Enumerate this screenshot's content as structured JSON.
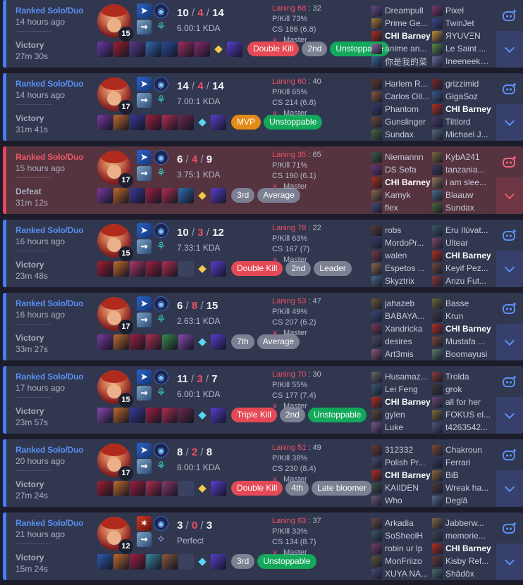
{
  "colors": {
    "win": "#4a7df0",
    "loss": "#e2475d",
    "badge_red": "#e44a55",
    "badge_green": "#13a85a",
    "badge_gray": "#7b8092",
    "badge_orange": "#e38b17"
  },
  "matches": [
    {
      "result_type": "win",
      "queue": "Ranked Solo/Duo",
      "ago": "14 hours ago",
      "result": "Victory",
      "duration": "27m 30s",
      "level": "15",
      "spell": "flash",
      "secondary": "resolve",
      "k": "10",
      "d": "4",
      "a": "14",
      "ratio": "6.00:1 KDA",
      "laning": "Laning 68",
      "laning_opp": "32",
      "pkill": "P/Kill 73%",
      "cs": "CS 186 (6.8)",
      "rank": "Master",
      "items": [
        "#6d3aa8",
        "#a02030",
        "#5b3a8c",
        "#2f6cb0",
        "#2b4d9c",
        "#a02d5e",
        "#8a2a6e",
        "ward",
        "#5a3ed0"
      ],
      "badges": [
        {
          "t": "Double Kill",
          "c": "red"
        },
        {
          "t": "2nd",
          "c": "gray"
        },
        {
          "t": "Unstoppable",
          "c": "green"
        }
      ],
      "blue": [
        {
          "n": "Dreampull",
          "c": "#6a4a8a"
        },
        {
          "n": "Prime Ge...",
          "c": "#a87a3a"
        },
        {
          "n": "CHI Barney",
          "c": "#b03020",
          "me": true
        },
        {
          "n": "anime an...",
          "c": "#8a6aa0"
        },
        {
          "n": "你是我的菜",
          "c": "#3a6a9a"
        }
      ],
      "red": [
        {
          "n": "Pixel",
          "c": "#7a3a6a"
        },
        {
          "n": "TwinJet",
          "c": "#3a4a8a"
        },
        {
          "n": "ЯYUVΞN",
          "c": "#c08a3a"
        },
        {
          "n": "Le Saint ...",
          "c": "#5a8a4a"
        },
        {
          "n": "Ineeneekh...",
          "c": "#6a6a9a"
        }
      ]
    },
    {
      "result_type": "win",
      "queue": "Ranked Solo/Duo",
      "ago": "14 hours ago",
      "result": "Victory",
      "duration": "31m 41s",
      "level": "17",
      "spell": "flash",
      "secondary": "resolve",
      "k": "14",
      "d": "4",
      "a": "14",
      "ratio": "7.00:1 KDA",
      "laning": "Laning 60",
      "laning_opp": "40",
      "pkill": "P/Kill 65%",
      "cs": "CS 214 (6.8)",
      "rank": "Master",
      "items": [
        "#7a3aa0",
        "#c06a2a",
        "#3a3a9a",
        "#a02040",
        "#b03050",
        "#6a2a4a",
        "ward-blue",
        "#5a3ed0"
      ],
      "badges": [
        {
          "t": "MVP",
          "c": "orange"
        },
        {
          "t": "Unstoppable",
          "c": "green"
        }
      ],
      "blue": [
        {
          "n": "Harlem R...",
          "c": "#5a3a2a"
        },
        {
          "n": "Carlos Oil...",
          "c": "#8a5a3a"
        },
        {
          "n": "Phantom",
          "c": "#3a3a6a"
        },
        {
          "n": "Gunslinger",
          "c": "#6a4a3a"
        },
        {
          "n": "Sundax",
          "c": "#4a6a3a"
        }
      ],
      "red": [
        {
          "n": "grizzimid",
          "c": "#7a2a2a"
        },
        {
          "n": "GigaSoz",
          "c": "#3a5a8a"
        },
        {
          "n": "CHI Barney",
          "c": "#b03020",
          "me": true
        },
        {
          "n": "Tiltlord",
          "c": "#4a3a6a"
        },
        {
          "n": "Michael J...",
          "c": "#5a6a7a"
        }
      ]
    },
    {
      "result_type": "loss",
      "queue": "Ranked Solo/Duo",
      "ago": "15 hours ago",
      "result": "Defeat",
      "duration": "31m 12s",
      "level": "17",
      "spell": "flash",
      "secondary": "resolve",
      "k": "6",
      "d": "4",
      "a": "9",
      "ratio": "3.75:1 KDA",
      "laning": "Laning 35",
      "laning_opp": "65",
      "pkill": "P/Kill 71%",
      "cs": "CS 190 (6.1)",
      "rank": "Master",
      "items": [
        "#7a3aa0",
        "#c06a2a",
        "#3a3a9a",
        "#a02040",
        "#b03050",
        "#2f6cb0",
        "ward",
        "#5a3ed0"
      ],
      "badges": [
        {
          "t": "3rd",
          "c": "gray"
        },
        {
          "t": "Average",
          "c": "gray"
        }
      ],
      "blue": [
        {
          "n": "Niemannn",
          "c": "#3a5a4a"
        },
        {
          "n": "DS Sefa",
          "c": "#6a3a7a"
        },
        {
          "n": "CHI Barney",
          "c": "#b03020",
          "me": true
        },
        {
          "n": "Kamyk",
          "c": "#8a6a4a"
        },
        {
          "n": "flex",
          "c": "#4a4a7a"
        }
      ],
      "red": [
        {
          "n": "KybA241",
          "c": "#7a6a3a"
        },
        {
          "n": "tanzania...",
          "c": "#3a3a5a"
        },
        {
          "n": "i am slee...",
          "c": "#9a7a5a"
        },
        {
          "n": "Blaauw",
          "c": "#4a6a8a"
        },
        {
          "n": "Sundax",
          "c": "#4a6a3a"
        }
      ]
    },
    {
      "result_type": "win",
      "queue": "Ranked Solo/Duo",
      "ago": "16 hours ago",
      "result": "Victory",
      "duration": "23m 48s",
      "level": "15",
      "spell": "flash",
      "secondary": "resolve",
      "k": "10",
      "d": "3",
      "a": "12",
      "ratio": "7.33:1 KDA",
      "laning": "Laning 78",
      "laning_opp": "22",
      "pkill": "P/Kill 63%",
      "cs": "CS 167 (7)",
      "rank": "Master",
      "items": [
        "#a02030",
        "#c06a2a",
        "#b03a6a",
        "#a02040",
        "#b03050",
        "empty",
        "ward",
        "#5a3ed0"
      ],
      "badges": [
        {
          "t": "Double Kill",
          "c": "red"
        },
        {
          "t": "2nd",
          "c": "gray"
        },
        {
          "t": "Leader",
          "c": "gray"
        }
      ],
      "blue": [
        {
          "n": "robs",
          "c": "#5a3a3a"
        },
        {
          "n": "MordoPr...",
          "c": "#3a3a6a"
        },
        {
          "n": "walen",
          "c": "#7a3a4a"
        },
        {
          "n": "Espetos ...",
          "c": "#8a6a4a"
        },
        {
          "n": "Skyztrix",
          "c": "#4a6a8a"
        }
      ],
      "red": [
        {
          "n": "Eru Ilúvat...",
          "c": "#3a5a6a"
        },
        {
          "n": "Ultear",
          "c": "#7a4a6a"
        },
        {
          "n": "CHI Barney",
          "c": "#b03020",
          "me": true
        },
        {
          "n": "Keyif Pez...",
          "c": "#6a4a3a"
        },
        {
          "n": "Anzu Fut...",
          "c": "#8a3a3a"
        }
      ]
    },
    {
      "result_type": "win",
      "queue": "Ranked Solo/Duo",
      "ago": "16 hours ago",
      "result": "Victory",
      "duration": "33m 27s",
      "level": "17",
      "spell": "flash",
      "secondary": "resolve",
      "k": "6",
      "d": "8",
      "a": "15",
      "ratio": "2.63:1 KDA",
      "laning": "Laning 53",
      "laning_opp": "47",
      "pkill": "P/Kill 49%",
      "cs": "CS 207 (6.2)",
      "rank": "Master",
      "items": [
        "#7a3aa0",
        "#c06a2a",
        "#a02040",
        "#b03050",
        "#3a8a4a",
        "#8a4ab0",
        "ward-blue",
        "#5a3ed0"
      ],
      "badges": [
        {
          "t": "7th",
          "c": "gray"
        },
        {
          "t": "Average",
          "c": "gray"
        }
      ],
      "blue": [
        {
          "n": "jahazeb",
          "c": "#6a5a3a"
        },
        {
          "n": "BABAYA...",
          "c": "#3a4a7a"
        },
        {
          "n": "Xandricka",
          "c": "#7a3a5a"
        },
        {
          "n": "desires",
          "c": "#4a4a6a"
        },
        {
          "n": "Art3mis",
          "c": "#8a5a7a"
        }
      ],
      "red": [
        {
          "n": "Basse",
          "c": "#6a6a3a"
        },
        {
          "n": "Krun",
          "c": "#3a3a4a"
        },
        {
          "n": "CHI Barney",
          "c": "#b03020",
          "me": true
        },
        {
          "n": "Mustafa ...",
          "c": "#7a4a3a"
        },
        {
          "n": "Boomayusi",
          "c": "#5a7a6a"
        }
      ]
    },
    {
      "result_type": "win",
      "queue": "Ranked Solo/Duo",
      "ago": "17 hours ago",
      "result": "Victory",
      "duration": "23m 57s",
      "level": "15",
      "spell": "flash",
      "secondary": "resolve",
      "k": "11",
      "d": "3",
      "a": "7",
      "ratio": "6.00:1 KDA",
      "laning": "Laning 70",
      "laning_opp": "30",
      "pkill": "P/Kill 55%",
      "cs": "CS 177 (7.4)",
      "rank": "Master",
      "items": [
        "#8a4ab0",
        "#c06a2a",
        "#3a3a9a",
        "#a02040",
        "#b03050",
        "#6a2a4a",
        "ward-blue",
        "#5a3ed0"
      ],
      "badges": [
        {
          "t": "Triple Kill",
          "c": "red"
        },
        {
          "t": "2nd",
          "c": "gray"
        },
        {
          "t": "Unstoppable",
          "c": "green"
        }
      ],
      "blue": [
        {
          "n": "Husamaz...",
          "c": "#6a6a6a"
        },
        {
          "n": "Lei Feng",
          "c": "#3a5a7a"
        },
        {
          "n": "CHI Barney",
          "c": "#b03020",
          "me": true
        },
        {
          "n": "gylen",
          "c": "#5a4a3a"
        },
        {
          "n": "Luke",
          "c": "#7a5a8a"
        }
      ],
      "red": [
        {
          "n": "Trolda",
          "c": "#8a3a3a"
        },
        {
          "n": "grok",
          "c": "#3a3a3a"
        },
        {
          "n": "all for her",
          "c": "#6a4a7a"
        },
        {
          "n": "FOKUS el...",
          "c": "#7a6a3a"
        },
        {
          "n": "t4263542...",
          "c": "#4a5a7a"
        }
      ]
    },
    {
      "result_type": "win",
      "queue": "Ranked Solo/Duo",
      "ago": "20 hours ago",
      "result": "Victory",
      "duration": "27m 24s",
      "level": "17",
      "spell": "flash",
      "secondary": "resolve",
      "k": "8",
      "d": "2",
      "a": "8",
      "ratio": "8.00:1 KDA",
      "laning": "Laning 51",
      "laning_opp": "49",
      "pkill": "P/Kill 38%",
      "cs": "CS 230 (8.4)",
      "rank": "Master",
      "items": [
        "#a02030",
        "#c06a2a",
        "#a02040",
        "#b03050",
        "#8a3a6a",
        "empty",
        "ward",
        "#5a3ed0"
      ],
      "badges": [
        {
          "t": "Double Kill",
          "c": "red"
        },
        {
          "t": "4th",
          "c": "gray"
        },
        {
          "t": "Late bloomer",
          "c": "gray"
        }
      ],
      "blue": [
        {
          "n": "312332",
          "c": "#6a3a3a"
        },
        {
          "n": "Polish Pr...",
          "c": "#4a4a6a"
        },
        {
          "n": "CHI Barney",
          "c": "#b03020",
          "me": true
        },
        {
          "n": "KAIIDEN",
          "c": "#3a5a4a"
        },
        {
          "n": "Who",
          "c": "#6a5a7a"
        }
      ],
      "red": [
        {
          "n": "Chakroun",
          "c": "#7a4a3a"
        },
        {
          "n": "Ferrari",
          "c": "#3a3a5a"
        },
        {
          "n": "BiB",
          "c": "#8a6a3a"
        },
        {
          "n": "Wreak ha...",
          "c": "#4a3a3a"
        },
        {
          "n": "Deglâ",
          "c": "#5a6a8a"
        }
      ]
    },
    {
      "result_type": "win",
      "queue": "Ranked Solo/Duo",
      "ago": "21 hours ago",
      "result": "Victory",
      "duration": "15m 24s",
      "level": "12",
      "spell": "ignite",
      "secondary": "inspiration",
      "k": "3",
      "d": "0",
      "a": "3",
      "ratio": "Perfect",
      "laning": "Laning 63",
      "laning_opp": "37",
      "pkill": "P/Kill 33%",
      "cs": "CS 134 (8.7)",
      "rank": "Master",
      "items": [
        "#2f5cb0",
        "#c06a2a",
        "#a02040",
        "#3a8aa0",
        "#8a5a3a",
        "empty",
        "ward-blue",
        "#5a3ed0"
      ],
      "badges": [
        {
          "t": "3rd",
          "c": "gray"
        },
        {
          "t": "Unstoppable",
          "c": "green"
        }
      ],
      "blue": [
        {
          "n": "Arkadia",
          "c": "#6a4a4a"
        },
        {
          "n": "SoSheolH",
          "c": "#3a5a6a"
        },
        {
          "n": "robin ur lp",
          "c": "#7a3a6a"
        },
        {
          "n": "MonFriizo",
          "c": "#5a5a3a"
        },
        {
          "n": "XUYA NA...",
          "c": "#4a4a7a"
        }
      ],
      "red": [
        {
          "n": "Jabberw...",
          "c": "#7a6a4a"
        },
        {
          "n": "memorie...",
          "c": "#3a4a5a"
        },
        {
          "n": "CHI Barney",
          "c": "#b03020",
          "me": true
        },
        {
          "n": "Kisby Ref...",
          "c": "#6a3a3a"
        },
        {
          "n": "Shâdôx",
          "c": "#4a6a6a"
        }
      ]
    }
  ]
}
